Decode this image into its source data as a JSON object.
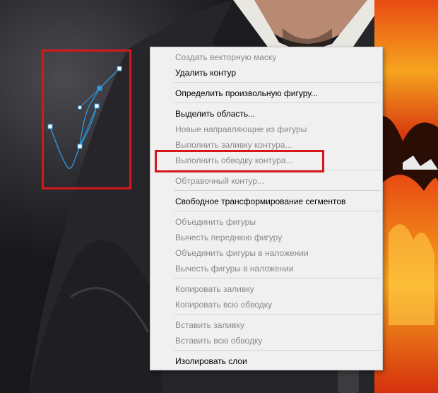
{
  "context_menu": {
    "items": [
      {
        "label": "Создать векторную маску",
        "enabled": false
      },
      {
        "label": "Удалить контур",
        "enabled": true
      },
      {
        "label": "Определить произвольную фигуру...",
        "enabled": true
      },
      {
        "label": "Выделить область...",
        "enabled": true
      },
      {
        "label": "Новые направляющие из фигуры",
        "enabled": false
      },
      {
        "label": "Выполнить заливку контура...",
        "enabled": false
      },
      {
        "label": "Выполнить обводку контура...",
        "enabled": false,
        "highlighted": true
      },
      {
        "label": "Обтравочный контур...",
        "enabled": false
      },
      {
        "label": "Свободное трансформирование сегментов",
        "enabled": true
      },
      {
        "label": "Объединить фигуры",
        "enabled": false
      },
      {
        "label": "Вычесть переднюю фигуру",
        "enabled": false
      },
      {
        "label": "Объединить фигуры в наложении",
        "enabled": false
      },
      {
        "label": "Вычесть фигуры в наложении",
        "enabled": false
      },
      {
        "label": "Копировать заливку",
        "enabled": false
      },
      {
        "label": "Копировать всю обводку",
        "enabled": false
      },
      {
        "label": "Вставить заливку",
        "enabled": false
      },
      {
        "label": "Вставить всю обводку",
        "enabled": false
      },
      {
        "label": "Изолировать слои",
        "enabled": true
      }
    ]
  },
  "colors": {
    "annotation_red": "#d6181b",
    "path_blue": "#2f9be0",
    "menu_bg": "#f0f0f0",
    "disabled_text": "#8a8a8a",
    "enabled_text": "#000000"
  }
}
